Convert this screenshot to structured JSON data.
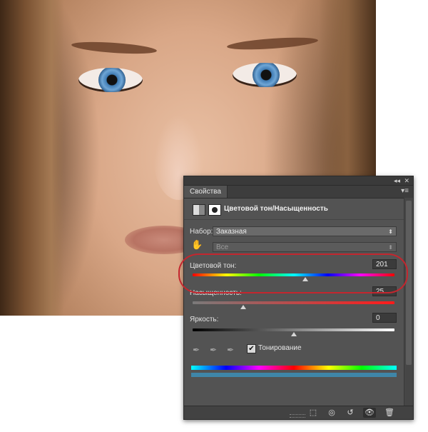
{
  "panel": {
    "tab": "Свойства",
    "title": "Цветовой тон/Насыщенность",
    "preset": {
      "label": "Набор:",
      "value": "Заказная"
    },
    "channel": {
      "value": "Все"
    },
    "hue": {
      "label": "Цветовой тон:",
      "value": "201",
      "level": 0.56
    },
    "saturation": {
      "label": "Насыщенность:",
      "value": "25",
      "level": 0.25
    },
    "lightness": {
      "label": "Яркость:",
      "value": "0",
      "level": 0.5
    },
    "colorize": {
      "label": "Тонирование",
      "checked": true
    },
    "tint_color": "#3f86a8",
    "icons": {
      "titlebar": [
        "collapse-icon",
        "close-icon"
      ],
      "tab_menu": "panel-menu-icon",
      "header": [
        "adjustment-icon",
        "mask-icon"
      ],
      "hand": "targeted-adjustment-hand-icon",
      "eyedroppers": [
        "eyedropper-icon",
        "eyedropper-add-icon",
        "eyedropper-subtract-icon"
      ],
      "footer": [
        "clip-to-layer-icon",
        "view-previous-state-icon",
        "reset-icon",
        "visibility-eye-icon",
        "trash-icon"
      ]
    }
  },
  "annotation": {
    "highlight_color": "#c4262e"
  }
}
